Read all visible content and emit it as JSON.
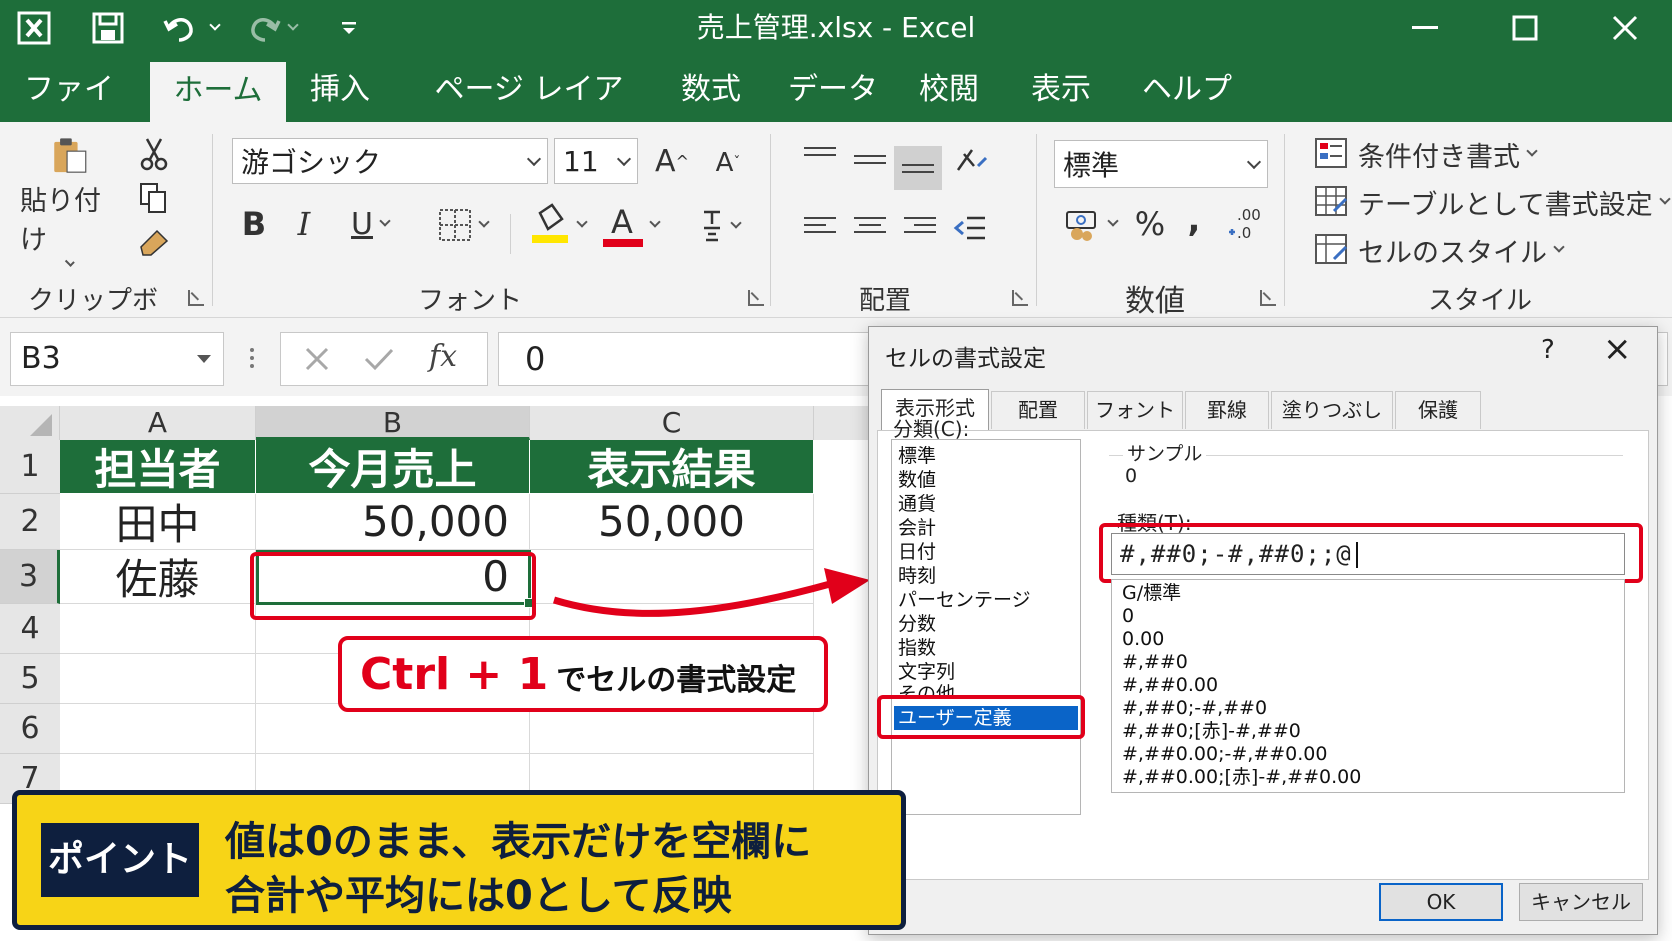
{
  "app": {
    "title": "売上管理.xlsx  -  Excel",
    "tabs": [
      "ファイル",
      "ホーム",
      "挿入",
      "ページ レイアウト",
      "数式",
      "データ",
      "校閲",
      "表示",
      "ヘルプ"
    ],
    "active_tab": "ホーム"
  },
  "ribbon": {
    "clipboard": {
      "paste_label": "貼り付け",
      "group_label": "クリップボード"
    },
    "font": {
      "font_name": "游ゴシック",
      "font_size": "11",
      "grow": "A",
      "shrink": "A",
      "bold": "B",
      "italic": "I",
      "underline": "U",
      "font_color_letter": "A",
      "group_label": "フォント"
    },
    "alignment": {
      "group_label": "配置"
    },
    "number": {
      "format": "標準",
      "percent": "%",
      "comma": ",",
      "decimal": ".00\n+.0",
      "group_label": "数値"
    },
    "styles": {
      "conditional": "条件付き書式",
      "table": "テーブルとして書式設定",
      "cell_styles": "セルのスタイル",
      "group_label": "スタイル"
    },
    "accent_color": "#1e6e3a"
  },
  "formula_bar": {
    "name_box": "B3",
    "value": "0"
  },
  "sheet": {
    "columns": [
      "A",
      "B",
      "C"
    ],
    "rows": [
      "1",
      "2",
      "3",
      "4",
      "5",
      "6",
      "7"
    ],
    "header_row": [
      "担当者",
      "今月売上",
      "表示結果"
    ],
    "row2": [
      "田中",
      "50,000",
      "50,000"
    ],
    "row3": [
      "佐藤",
      "0",
      ""
    ]
  },
  "dialog": {
    "title": "セルの書式設定",
    "help": "?",
    "close": "×",
    "tabs": [
      "表示形式",
      "配置",
      "フォント",
      "罫線",
      "塗りつぶし",
      "保護"
    ],
    "category_label": "分類(C):",
    "categories": [
      "標準",
      "数値",
      "通貨",
      "会計",
      "日付",
      "時刻",
      "パーセンテージ",
      "分数",
      "指数",
      "文字列",
      "その他",
      "ユーザー定義"
    ],
    "selected_category": "ユーザー定義",
    "sample_label": "サンプル",
    "sample_value": "0",
    "type_label": "種類(T):",
    "type_value": "#,##0;-#,##0;;@",
    "formats": [
      "G/標準",
      "0",
      "0.00",
      "#,##0",
      "#,##0.00",
      "#,##0;-#,##0",
      "#,##0;[赤]-#,##0",
      "#,##0.00;-#,##0.00",
      "#,##0.00;[赤]-#,##0.00"
    ],
    "ok": "OK",
    "cancel": "キャンセル"
  },
  "annotation": {
    "callout_key": "Ctrl + 1",
    "callout_text": "でセルの書式設定",
    "point_badge": "ポイント",
    "point_line1": "値は0のまま、表示だけを空欄に",
    "point_line2": "合計や平均には0として反映",
    "highlight_color": "#e1001a",
    "panel_color": "#f7d417"
  }
}
